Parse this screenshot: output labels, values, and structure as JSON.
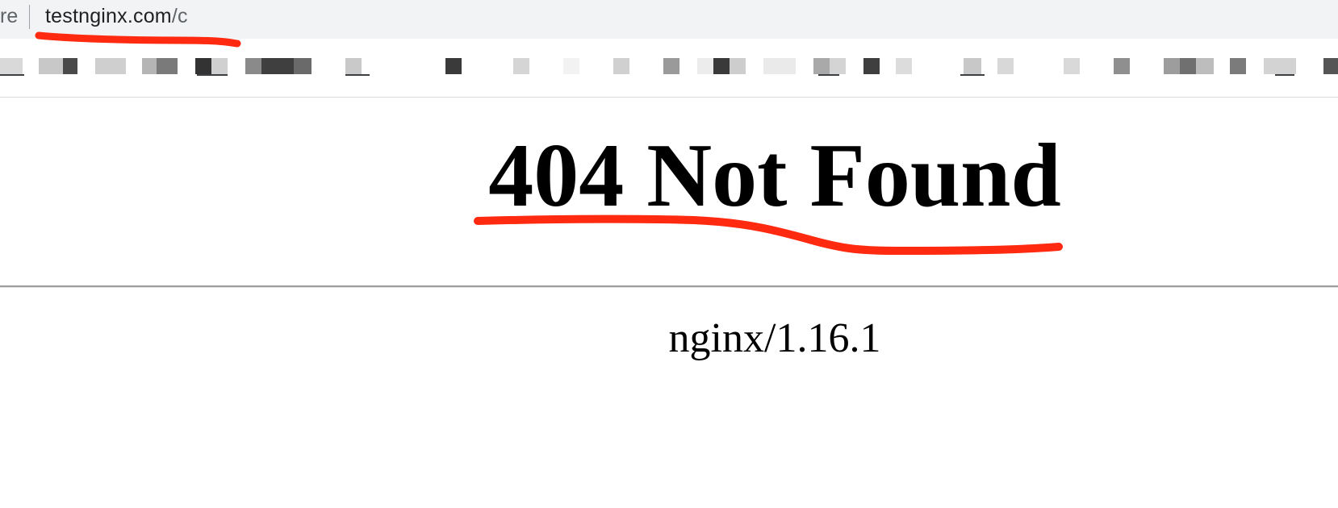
{
  "browser": {
    "security_label_fragment": "re",
    "url_host": "testnginx.com",
    "url_path": "/c",
    "bookmarks_bar": "pixelated"
  },
  "page": {
    "heading": "404 Not Found",
    "server_signature": "nginx/1.16.1"
  },
  "annotation": {
    "stroke_color": "#ff2a10"
  }
}
